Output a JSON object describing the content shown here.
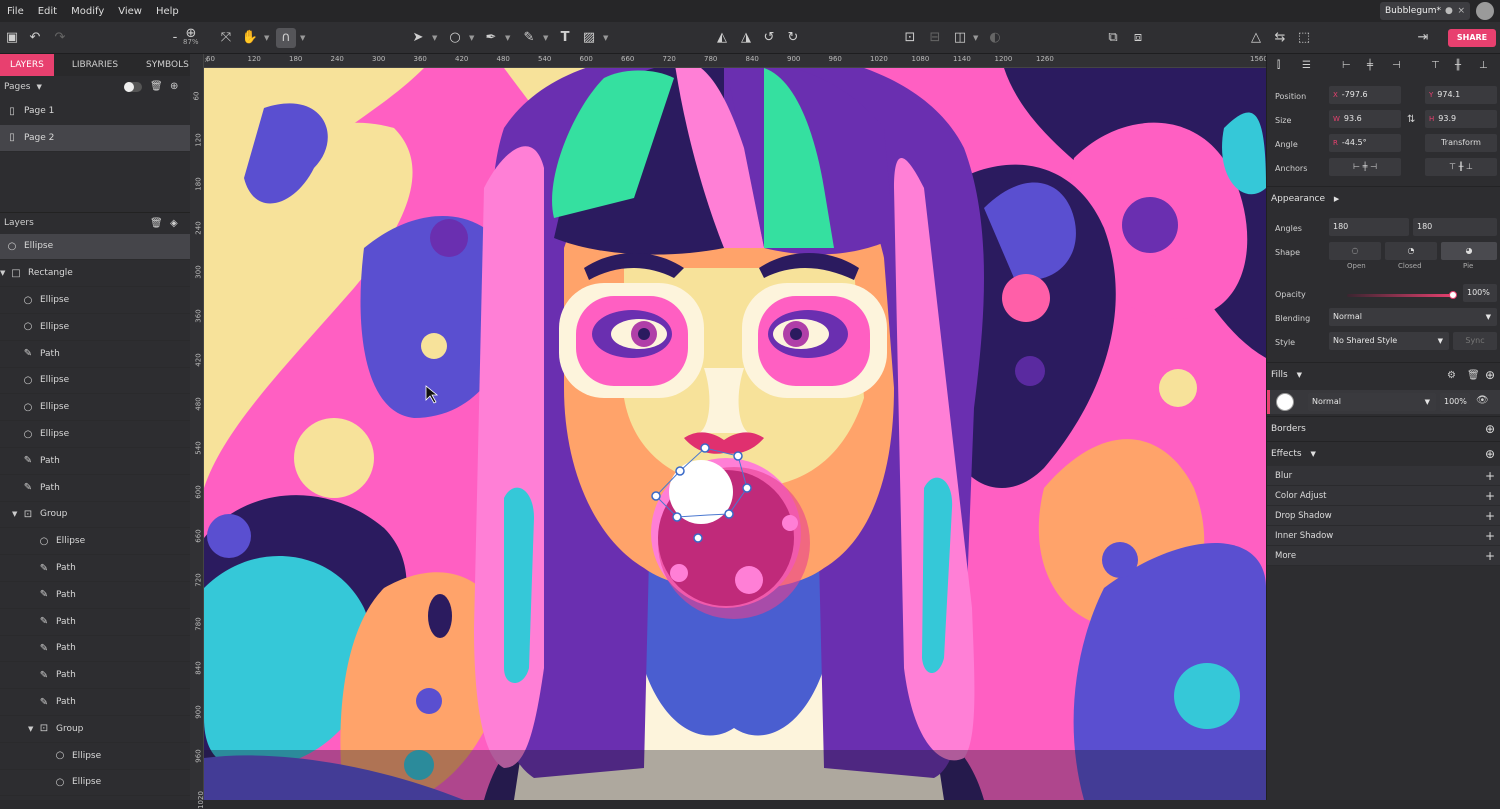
{
  "menu": [
    "File",
    "Edit",
    "Modify",
    "View",
    "Help"
  ],
  "doc_tab": {
    "title": "Bubblegum*",
    "close": "×"
  },
  "zoom": "87%",
  "share_label": "SHARE",
  "panel_tabs": [
    "LAYERS",
    "LIBRARIES",
    "SYMBOLS"
  ],
  "pages": {
    "header": "Pages",
    "items": [
      "Page 1",
      "Page 2"
    ]
  },
  "layers": {
    "header": "Layers",
    "items": [
      {
        "label": "Ellipse",
        "indent": 0,
        "icon": "ellipse",
        "selected": true
      },
      {
        "label": "Rectangle",
        "indent": 0,
        "icon": "rectangle",
        "arrow": true
      },
      {
        "label": "Ellipse",
        "indent": 1,
        "icon": "ellipse"
      },
      {
        "label": "Ellipse",
        "indent": 1,
        "icon": "ellipse"
      },
      {
        "label": "Path",
        "indent": 1,
        "icon": "path"
      },
      {
        "label": "Ellipse",
        "indent": 1,
        "icon": "ellipse"
      },
      {
        "label": "Ellipse",
        "indent": 1,
        "icon": "ellipse"
      },
      {
        "label": "Ellipse",
        "indent": 1,
        "icon": "ellipse"
      },
      {
        "label": "Path",
        "indent": 1,
        "icon": "path"
      },
      {
        "label": "Path",
        "indent": 1,
        "icon": "path"
      },
      {
        "label": "Group",
        "indent": 1,
        "icon": "group",
        "arrow": true
      },
      {
        "label": "Ellipse",
        "indent": 2,
        "icon": "ellipse"
      },
      {
        "label": "Path",
        "indent": 2,
        "icon": "path"
      },
      {
        "label": "Path",
        "indent": 2,
        "icon": "path"
      },
      {
        "label": "Path",
        "indent": 2,
        "icon": "path"
      },
      {
        "label": "Path",
        "indent": 2,
        "icon": "path"
      },
      {
        "label": "Path",
        "indent": 2,
        "icon": "path"
      },
      {
        "label": "Path",
        "indent": 2,
        "icon": "path"
      },
      {
        "label": "Group",
        "indent": 2,
        "icon": "group",
        "arrow": true
      },
      {
        "label": "Ellipse",
        "indent": 3,
        "icon": "ellipse"
      },
      {
        "label": "Ellipse",
        "indent": 3,
        "icon": "ellipse"
      }
    ]
  },
  "ruler_h": [
    "60",
    "120",
    "180",
    "240",
    "300",
    "360",
    "420",
    "480",
    "540",
    "600",
    "660",
    "720",
    "780",
    "840",
    "900",
    "960",
    "1020",
    "1080",
    "1140",
    "1200",
    "1260",
    "1560"
  ],
  "ruler_v": [
    "60",
    "120",
    "180",
    "240",
    "300",
    "360",
    "420",
    "480",
    "540",
    "600",
    "660",
    "720",
    "780",
    "840",
    "900",
    "960",
    "1020"
  ],
  "ruler_unit": "px",
  "inspector": {
    "position": {
      "label": "Position",
      "x": "-797.6",
      "y": "974.1"
    },
    "size": {
      "label": "Size",
      "w": "93.6",
      "h": "93.9"
    },
    "angle": {
      "label": "Angle",
      "value": "-44.5°",
      "transform": "Transform"
    },
    "anchors": {
      "label": "Anchors"
    },
    "appearance": "Appearance",
    "angles": {
      "label": "Angles",
      "a": "180",
      "b": "180"
    },
    "shape": {
      "label": "Shape",
      "open": "Open",
      "closed": "Closed",
      "pie": "Pie"
    },
    "opacity": {
      "label": "Opacity",
      "value": "100%",
      "level": 1.0
    },
    "blending": {
      "label": "Blending",
      "value": "Normal"
    },
    "style": {
      "label": "Style",
      "value": "No Shared Style",
      "sync": "Sync"
    },
    "fills": {
      "label": "Fills",
      "mode": "Normal",
      "opacity": "100%"
    },
    "borders": "Borders",
    "effects": {
      "label": "Effects",
      "items": [
        "Blur",
        "Color Adjust",
        "Drop Shadow",
        "Inner Shadow",
        "More"
      ]
    }
  },
  "accent": "#e8406f"
}
